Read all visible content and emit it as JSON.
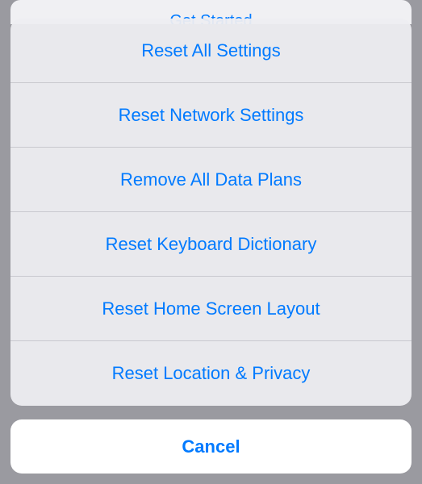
{
  "background": {
    "partial_text": "Get Started"
  },
  "actionSheet": {
    "options": [
      {
        "label": "Reset All Settings"
      },
      {
        "label": "Reset Network Settings"
      },
      {
        "label": "Remove All Data Plans"
      },
      {
        "label": "Reset Keyboard Dictionary"
      },
      {
        "label": "Reset Home Screen Layout"
      },
      {
        "label": "Reset Location & Privacy"
      }
    ],
    "cancel_label": "Cancel"
  },
  "colors": {
    "accent": "#007aff",
    "sheet_bg": "#ededf1",
    "cancel_bg": "#ffffff"
  }
}
